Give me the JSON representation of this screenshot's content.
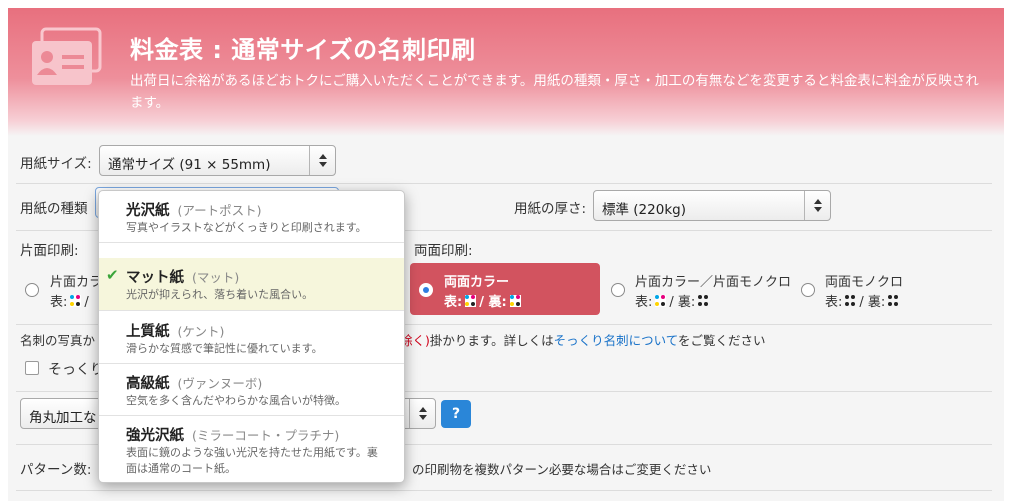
{
  "header": {
    "title": "料金表 : 通常サイズの名刺印刷",
    "description": "出荷日に余裕があるほどおトクにご購入いただくことができます。用紙の種類・厚さ・加工の有無などを変更すると料金表に料金が反映されます。"
  },
  "form": {
    "paper_size_label": "用紙サイズ:",
    "paper_size_value": "通常サイズ (91 × 55mm)",
    "paper_type_label": "用紙の種類",
    "paper_thickness_label": "用紙の厚さ:",
    "paper_thickness_value": "標準 (220kg)",
    "single_side_label": "片面印刷:",
    "double_side_label": "両面印刷:",
    "options": [
      {
        "name": "片面カラー",
        "front": "表:",
        "back": "/"
      },
      {
        "name": "両面カラー",
        "front": "表:",
        "back": "/ 裏:"
      },
      {
        "name": "片面カラー／片面モノクロ",
        "front": "表:",
        "back": "/ 裏:"
      },
      {
        "name": "両面モノクロ",
        "front": "表:",
        "back": "/ 裏:"
      }
    ],
    "note_prefix": "名刺の写真か",
    "note_red": "除く)",
    "note_mid": "掛かります。詳しくは",
    "note_link": "そっくり名刺について",
    "note_suffix": "をご覧ください",
    "sokkuri_label": "そっくり",
    "corner_select_value": "角丸加工な",
    "help_label": "?",
    "pattern_label": "パターン数:",
    "pattern_note": "の印刷物を複数パターン必要な場合はご変更ください"
  },
  "dropdown": {
    "items": [
      {
        "title": "光沢紙",
        "sub": "(アートポスト)",
        "desc": "写真やイラストなどがくっきりと印刷されます。",
        "selected": false
      },
      {
        "title": "マット紙",
        "sub": "(マット)",
        "desc": "光沢が抑えられ、落ち着いた風合い。",
        "selected": true
      },
      {
        "title": "上質紙",
        "sub": "(ケント)",
        "desc": "滑らかな質感で筆記性に優れています。",
        "selected": false
      },
      {
        "title": "高級紙",
        "sub": "(ヴァンヌーボ)",
        "desc": "空気を多く含んだやわらかな風合いが特徴。",
        "selected": false
      },
      {
        "title": "強光沢紙",
        "sub": "(ミラーコート・プラチナ)",
        "desc": "表面に鏡のような強い光沢を持たせた用紙です。裏面は通常のコート紙。",
        "selected": false
      }
    ]
  },
  "colors": {
    "header_accent": "#e8707e",
    "selected_option": "#d2535f",
    "link": "#1a73c9",
    "help_button": "#2a86d8",
    "check": "#3aa53a"
  }
}
